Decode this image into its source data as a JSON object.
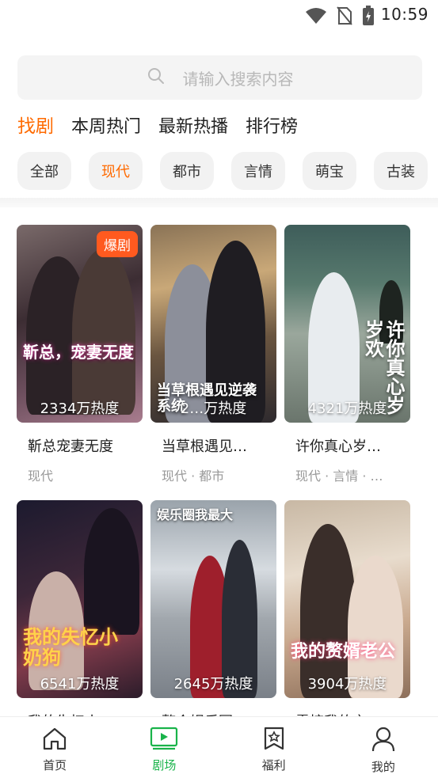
{
  "status_bar": {
    "time": "10:59",
    "icons": [
      "wifi-icon",
      "no-sim-icon",
      "battery-charging-icon"
    ]
  },
  "search": {
    "placeholder": "请输入搜索内容",
    "icon": "search-icon"
  },
  "main_tabs": [
    {
      "label": "找剧",
      "active": true
    },
    {
      "label": "本周热门",
      "active": false
    },
    {
      "label": "最新热播",
      "active": false
    },
    {
      "label": "排行榜",
      "active": false
    }
  ],
  "categories": [
    {
      "label": "全部",
      "active": false
    },
    {
      "label": "现代",
      "active": true
    },
    {
      "label": "都市",
      "active": false
    },
    {
      "label": "言情",
      "active": false
    },
    {
      "label": "萌宝",
      "active": false
    },
    {
      "label": "古装",
      "active": false
    }
  ],
  "dramas": [
    {
      "title": "靳总宠妻无度",
      "heat": "2334万热度",
      "tags": "现代",
      "badge": "爆剧",
      "poster_text": "靳总，宠妻无度"
    },
    {
      "title": "当草根遇见…",
      "heat": "2…万热度",
      "tags": "现代 · 都市",
      "badge": "",
      "poster_text": "当草根遇见逆袭系统"
    },
    {
      "title": "许你真心岁…",
      "heat": "4321万热度",
      "tags": "现代 · 言情 · …",
      "badge": "",
      "poster_text": "许你真心岁岁欢"
    },
    {
      "title": "我的失忆小…",
      "heat": "6541万热度",
      "tags": "",
      "badge": "",
      "poster_text": "我的失忆小奶狗"
    },
    {
      "title": "整个娱乐圈…",
      "heat": "2645万热度",
      "tags": "",
      "badge": "",
      "poster_text": "娱乐圈我最大"
    },
    {
      "title": "震惊我的玄…",
      "heat": "3904万热度",
      "tags": "",
      "badge": "",
      "poster_text": "我的赘婿老公"
    }
  ],
  "bottom_nav": [
    {
      "label": "首页",
      "icon": "home-icon",
      "active": false
    },
    {
      "label": "剧场",
      "icon": "theater-icon",
      "active": true
    },
    {
      "label": "福利",
      "icon": "bookmark-star-icon",
      "active": false
    },
    {
      "label": "我的",
      "icon": "user-icon",
      "active": false
    }
  ],
  "colors": {
    "accent": "#ff6a00",
    "nav_active": "#19b34a",
    "badge": "#ff5a1f"
  }
}
